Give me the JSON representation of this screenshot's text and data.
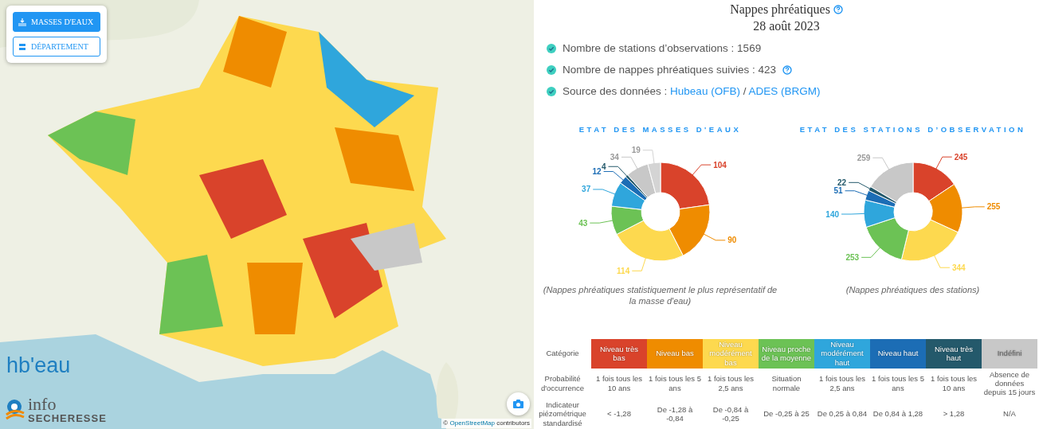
{
  "map": {
    "buttons": [
      {
        "label": "MASSES D'EAUX",
        "selected": true
      },
      {
        "label": "DÉPARTEMENT",
        "selected": false
      }
    ],
    "logo": "hb'eau",
    "brand": {
      "line1": "info",
      "line2": "SECHERESSE"
    },
    "attribution": {
      "symbol": "©",
      "link": "OpenStreetMap",
      "text": "contributors"
    }
  },
  "panel": {
    "title": "Nappes phréatiques",
    "date": "28 août 2023",
    "facts": [
      {
        "help": false,
        "parts": [
          {
            "kind": "text",
            "text": "Nombre de stations d’observations : 1569"
          }
        ]
      },
      {
        "help": true,
        "parts": [
          {
            "kind": "text",
            "text": "Nombre de nappes phréatiques suivies : 423"
          }
        ]
      },
      {
        "help": false,
        "parts": [
          {
            "kind": "text",
            "text": "Source des données : "
          },
          {
            "kind": "link",
            "text": "Hubeau (OFB)"
          },
          {
            "kind": "text",
            "text": " / "
          },
          {
            "kind": "link",
            "text": "ADES (BRGM)"
          }
        ]
      }
    ],
    "charts": [
      {
        "caption": "(Nappes phréatiques statistiquement le plus représentatif de la masse d'eau)",
        "chart_data": {
          "type": "donut",
          "title": "ETAT DES MASSES D'EAUX",
          "data_labels": true,
          "values": [
            104,
            90,
            114,
            43,
            37,
            12,
            4,
            34,
            19
          ],
          "colors": [
            "#d9432b",
            "#ef8c00",
            "#fdd94f",
            "#6cc255",
            "#2fa6dc",
            "#1c6db5",
            "#24596b",
            "#c8c8c8",
            "#d4d4d4"
          ]
        }
      },
      {
        "caption": "(Nappes phréatiques des stations)",
        "chart_data": {
          "type": "donut",
          "title": "ETAT DES STATIONS D’OBSERVATION",
          "data_labels": true,
          "values": [
            245,
            255,
            344,
            253,
            140,
            51,
            22,
            259
          ],
          "colors": [
            "#d9432b",
            "#ef8c00",
            "#fdd94f",
            "#6cc255",
            "#2fa6dc",
            "#1c6db5",
            "#24596b",
            "#c8c8c8"
          ]
        }
      }
    ],
    "legend": {
      "row_headers": [
        "Catégorie",
        "Probabilité d'occurrence",
        "Indicateur piézométrique standardisé"
      ],
      "categories": [
        {
          "label": "Niveau très bas",
          "color": "#d9432b",
          "probability": "1 fois tous les 10 ans",
          "indicator": "< -1,28"
        },
        {
          "label": "Niveau bas",
          "color": "#ef8c00",
          "probability": "1 fois tous les 5 ans",
          "indicator": "De -1,28 à -0,84"
        },
        {
          "label": "Niveau modérément bas",
          "color": "#fdd94f",
          "probability": "1 fois tous les 2,5 ans",
          "indicator": "De -0,84 à -0,25"
        },
        {
          "label": "Niveau proche de la moyenne",
          "color": "#6cc255",
          "probability": "Situation normale",
          "indicator": "De -0,25 à 25"
        },
        {
          "label": "Niveau modérément haut",
          "color": "#2fa6dc",
          "probability": "1 fois tous les 2,5 ans",
          "indicator": "De 0,25 à 0,84"
        },
        {
          "label": "Niveau haut",
          "color": "#1c6db5",
          "probability": "1 fois tous les 5 ans",
          "indicator": "De 0,84 à 1,28"
        },
        {
          "label": "Niveau très haut",
          "color": "#24596b",
          "probability": "1 fois tous les 10 ans",
          "indicator": "> 1,28"
        },
        {
          "label": "Indéfini",
          "color": "#c8c8c8",
          "probability": "Absence de données depuis 15 jours",
          "indicator": "N/A"
        }
      ]
    }
  }
}
